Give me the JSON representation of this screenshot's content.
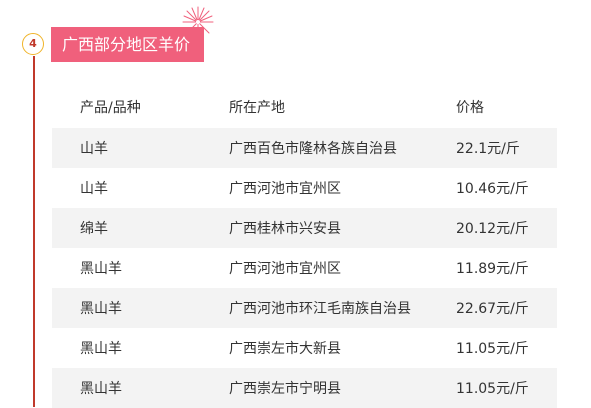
{
  "section": {
    "step_number": "4",
    "title": "广西部分地区羊价"
  },
  "table": {
    "headers": [
      "产品/品种",
      "所在产地",
      "价格"
    ],
    "rows": [
      [
        "山羊",
        "广西百色市隆林各族自治县",
        "22.1元/斤"
      ],
      [
        "山羊",
        "广西河池市宜州区",
        "10.46元/斤"
      ],
      [
        "绵羊",
        "广西桂林市兴安县",
        "20.12元/斤"
      ],
      [
        "黑山羊",
        "广西河池市宜州区",
        "11.89元/斤"
      ],
      [
        "黑山羊",
        "广西河池市环江毛南族自治县",
        "22.67元/斤"
      ],
      [
        "黑山羊",
        "广西崇左市大新县",
        "11.05元/斤"
      ],
      [
        "黑山羊",
        "广西崇左市宁明县",
        "11.05元/斤"
      ]
    ]
  },
  "colors": {
    "title_background": "#f0607c",
    "timeline": "#c0392b",
    "badge_border": "#f0b429",
    "row_shade": "#f3f3f3"
  },
  "icons": {
    "decoration": "firework-icon"
  }
}
